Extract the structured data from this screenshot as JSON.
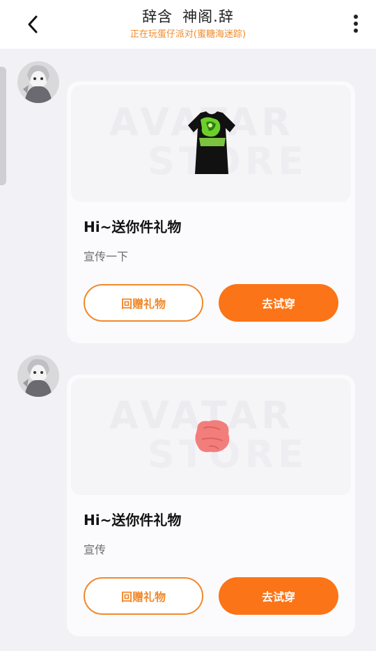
{
  "header": {
    "title_left": "辞含",
    "title_right": "神阁.辞",
    "subtitle": "正在玩蛋仔派对(蜜糖海迷踪)",
    "subtitle_color": "#f08a2a",
    "back_icon": "chevron-left-icon",
    "more_icon": "more-vertical-icon"
  },
  "watermark": {
    "line1": "AVATAR",
    "line2": "STORE"
  },
  "messages": [
    {
      "card_title": "Hi~送你件礼物",
      "card_desc": "宣传一下",
      "gift_icon": "black-tshirt-icon",
      "btn_return": "回赠礼物",
      "btn_try": "去试穿"
    },
    {
      "card_title": "Hi~送你件礼物",
      "card_desc": "宣传",
      "gift_icon": "pink-cloth-icon",
      "btn_return": "回赠礼物",
      "btn_try": "去试穿"
    }
  ],
  "colors": {
    "accent": "#fb7417",
    "accent_outline": "#f0892c",
    "background": "#f2f2f6"
  }
}
